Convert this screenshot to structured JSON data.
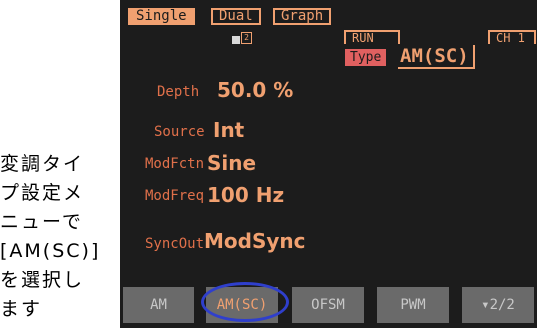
{
  "caption": {
    "lines": [
      "変調タイ",
      "プ設定メ",
      "ニューで",
      "[AM(SC)]",
      "を選択し",
      "ます"
    ]
  },
  "tabs": {
    "single": "Single",
    "dual": "Dual",
    "graph": "Graph"
  },
  "header": {
    "mini_index": "2",
    "run": "RUN",
    "channel": "CH 1",
    "type_label": "Type",
    "type_value": "AM(SC)"
  },
  "params": {
    "depth": {
      "label": "Depth",
      "value": "50.0 %"
    },
    "source": {
      "label": "Source",
      "value": "Int"
    },
    "modfctn": {
      "label": "ModFctn",
      "value": "Sine"
    },
    "modfreq": {
      "label": "ModFreq",
      "value": "100 Hz"
    },
    "syncout": {
      "label": "SyncOut",
      "value": "ModSync"
    }
  },
  "softkeys": {
    "am": "AM",
    "amsc": "AM(SC)",
    "ofsm": "OFSM",
    "pwm": "PWM",
    "page": "▾2/2"
  },
  "colors": {
    "screen_bg": "#1c1c1c",
    "accent": "#f0a070",
    "label": "#e0704a",
    "type_badge": "#e06060",
    "softkey_bg": "#6a6a6a",
    "highlight": "#2f3fcc"
  }
}
